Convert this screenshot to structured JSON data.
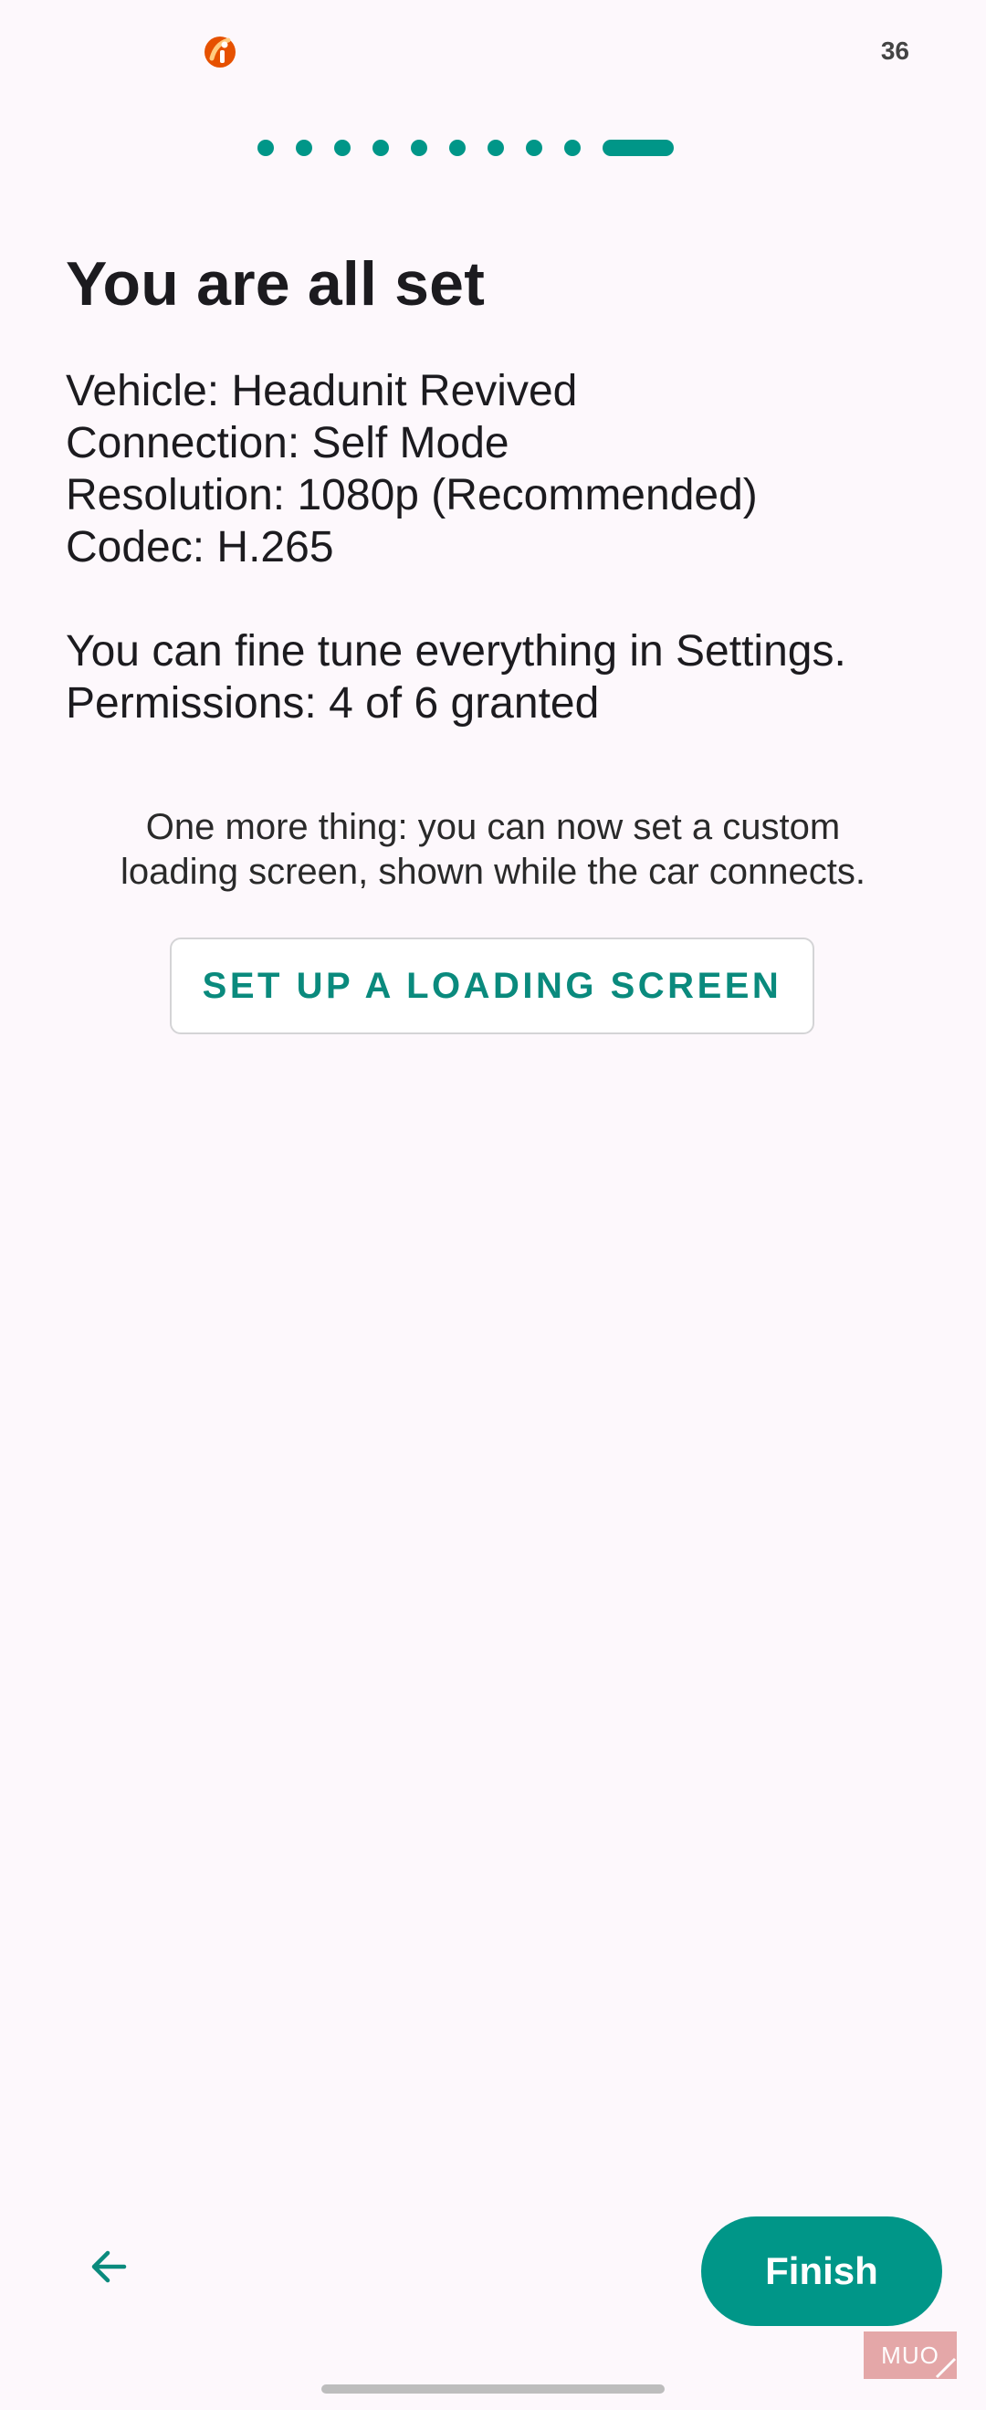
{
  "status_bar": {
    "battery_text": "36",
    "app_icon": "red-circle-brand-icon"
  },
  "stepper": {
    "steps_total": 10,
    "current_step": 10
  },
  "main": {
    "title": "You are all set",
    "vehicle": "Vehicle: Headunit Revived",
    "connection": "Connection: Self Mode",
    "resolution": "Resolution: 1080p (Recommended)",
    "codec": "Codec: H.265",
    "settings_hint": "You can fine tune everything in Settings.",
    "permissions": "Permissions: 4 of 6 granted",
    "extra_line1": "One more thing: you can now set a custom",
    "extra_line2": "loading screen, shown while the car connects.",
    "loading_button_label": "SET UP A LOADING SCREEN"
  },
  "footer": {
    "back_icon": "arrow-left-icon",
    "finish_label": "Finish"
  },
  "watermark": {
    "text": "MUO"
  },
  "colors": {
    "accent": "#009688",
    "background": "#fdf8fc",
    "text": "#1c1b1f"
  }
}
